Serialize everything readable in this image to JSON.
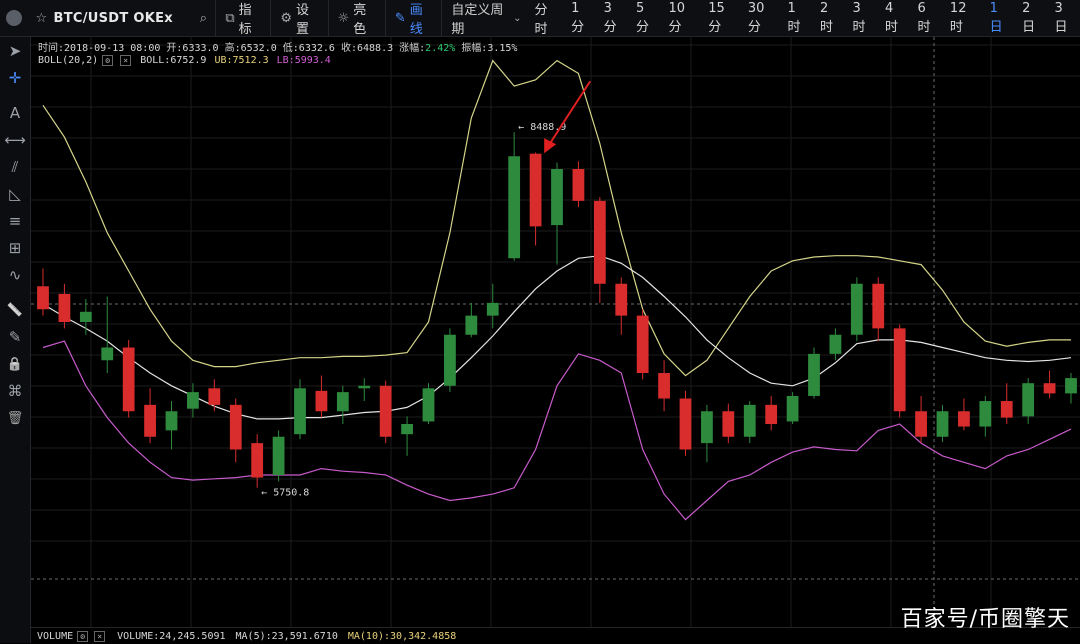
{
  "toolbar": {
    "symbol": "BTC/USDT OKEx",
    "star_icon": "star-icon",
    "search_icon": "search-icon",
    "indicators_label": "指标",
    "settings_label": "设置",
    "theme_label": "亮色",
    "draw_label": "画线",
    "custom_period_label": "自定义周期",
    "periods": [
      "分时",
      "1分",
      "3分",
      "5分",
      "10分",
      "15分",
      "30分",
      "1时",
      "2时",
      "3时",
      "4时",
      "6时",
      "12时",
      "1日",
      "2日",
      "3日"
    ],
    "active_period": "1日"
  },
  "sidebar": {
    "tools": [
      "cursor-arrow-icon",
      "crosshair-icon",
      "text-icon",
      "segment-icon",
      "parallel-lines-icon",
      "triangle-icon",
      "horizontal-lines-icon",
      "grid-icon",
      "wave-icon",
      "ruler-icon",
      "pen-icon",
      "lock-icon",
      "visibility-icon",
      "trash-icon"
    ]
  },
  "info": {
    "time_label": "时间:",
    "time": "2018-09-13 08:00",
    "open_label": "开:",
    "open": "6333.0",
    "high_label": "高:",
    "high": "6532.0",
    "low_label": "低:",
    "low": "6332.6",
    "close_label": "收:",
    "close": "6488.3",
    "change_label": "涨幅:",
    "change": "2.42%",
    "amplitude_label": "振幅:",
    "amplitude": "3.15%",
    "boll_name": "BOLL(20,2)",
    "boll_label": "BOLL:",
    "boll": "6752.9",
    "ub_label": "UB:",
    "ub": "7512.3",
    "lb_label": "LB:",
    "lb": "5993.4"
  },
  "volume": {
    "name": "VOLUME",
    "volume_label": "VOLUME:",
    "volume": "24,245.5091",
    "ma5_label": "MA(5):",
    "ma5": "23,591.6710",
    "ma10_label": "MA(10):",
    "ma10": "30,342.4858"
  },
  "watermark": "百家号/币圈擎天",
  "colors": {
    "up": "#2e8b3e",
    "down": "#d92d2d",
    "boll_mid": "#e4e4e4",
    "boll_ub": "#d4d48a",
    "boll_lb": "#c75bcb",
    "arrow": "#e02020",
    "accent": "#4a8dff"
  },
  "chart_data": {
    "type": "candlestick",
    "y_range": [
      5000,
      9000
    ],
    "annotations": [
      {
        "text": "← 8488.9",
        "index": 22,
        "price": 8488.9,
        "kind": "high"
      },
      {
        "text": "← 5750.8",
        "index": 10,
        "price": 5750.8,
        "kind": "low"
      }
    ],
    "candles": [
      [
        7280,
        7420,
        7050,
        7100
      ],
      [
        7220,
        7300,
        6950,
        7000
      ],
      [
        7000,
        7180,
        6900,
        7080
      ],
      [
        6700,
        7200,
        6600,
        6800
      ],
      [
        6800,
        6860,
        6250,
        6300
      ],
      [
        6350,
        6480,
        6050,
        6100
      ],
      [
        6150,
        6380,
        6000,
        6300
      ],
      [
        6320,
        6520,
        6250,
        6450
      ],
      [
        6480,
        6550,
        6300,
        6350
      ],
      [
        6350,
        6400,
        5900,
        6000
      ],
      [
        6050,
        6120,
        5700,
        5780
      ],
      [
        5800,
        6150,
        5750,
        6100
      ],
      [
        6120,
        6550,
        6080,
        6480
      ],
      [
        6460,
        6580,
        6250,
        6300
      ],
      [
        6300,
        6500,
        6200,
        6450
      ],
      [
        6480,
        6560,
        6380,
        6500
      ],
      [
        6500,
        6540,
        6050,
        6100
      ],
      [
        6120,
        6260,
        5950,
        6200
      ],
      [
        6220,
        6520,
        6200,
        6480
      ],
      [
        6500,
        6950,
        6450,
        6900
      ],
      [
        6900,
        7150,
        6880,
        7050
      ],
      [
        7050,
        7300,
        6950,
        7150
      ],
      [
        7500,
        8488.9,
        7480,
        8300
      ],
      [
        8320,
        8330,
        7600,
        7750
      ],
      [
        7760,
        8250,
        7450,
        8200
      ],
      [
        8200,
        8260,
        7900,
        7950
      ],
      [
        7950,
        7980,
        7150,
        7300
      ],
      [
        7300,
        7350,
        6900,
        7050
      ],
      [
        7050,
        7100,
        6550,
        6600
      ],
      [
        6600,
        6700,
        6300,
        6400
      ],
      [
        6400,
        6460,
        5950,
        6000
      ],
      [
        6050,
        6350,
        5900,
        6300
      ],
      [
        6300,
        6360,
        6050,
        6100
      ],
      [
        6100,
        6380,
        6050,
        6350
      ],
      [
        6350,
        6420,
        6150,
        6200
      ],
      [
        6220,
        6450,
        6200,
        6420
      ],
      [
        6420,
        6800,
        6400,
        6750
      ],
      [
        6750,
        6950,
        6700,
        6900
      ],
      [
        6900,
        7350,
        6850,
        7300
      ],
      [
        7300,
        7350,
        6850,
        6950
      ],
      [
        6950,
        6980,
        6250,
        6300
      ],
      [
        6300,
        6420,
        6050,
        6100
      ],
      [
        6100,
        6350,
        6060,
        6300
      ],
      [
        6300,
        6400,
        6150,
        6180
      ],
      [
        6180,
        6420,
        6100,
        6380
      ],
      [
        6380,
        6520,
        6200,
        6250
      ],
      [
        6260,
        6560,
        6200,
        6520
      ],
      [
        6520,
        6620,
        6400,
        6440
      ],
      [
        6440,
        6600,
        6360,
        6560
      ]
    ],
    "boll_mid": [
      7140,
      7040,
      6950,
      6850,
      6720,
      6600,
      6500,
      6420,
      6340,
      6280,
      6240,
      6240,
      6250,
      6250,
      6270,
      6290,
      6300,
      6330,
      6420,
      6560,
      6720,
      6890,
      7080,
      7260,
      7400,
      7500,
      7520,
      7460,
      7350,
      7200,
      7040,
      6860,
      6720,
      6600,
      6520,
      6500,
      6560,
      6680,
      6830,
      6860,
      6860,
      6840,
      6800,
      6760,
      6720,
      6700,
      6690,
      6700,
      6720
    ],
    "boll_ub": [
      8700,
      8450,
      8100,
      7700,
      7400,
      7100,
      6850,
      6700,
      6650,
      6650,
      6680,
      6700,
      6720,
      6720,
      6730,
      6730,
      6740,
      6760,
      7000,
      7700,
      8600,
      9050,
      8850,
      8900,
      9050,
      8950,
      8400,
      7700,
      7100,
      6750,
      6580,
      6700,
      6950,
      7200,
      7400,
      7480,
      7510,
      7520,
      7520,
      7510,
      7480,
      7450,
      7250,
      7000,
      6850,
      6810,
      6840,
      6860,
      6860
    ],
    "boll_lb": [
      6800,
      6850,
      6500,
      6250,
      6050,
      5900,
      5780,
      5760,
      5770,
      5780,
      5800,
      5800,
      5800,
      5850,
      5830,
      5820,
      5800,
      5720,
      5650,
      5600,
      5620,
      5650,
      5700,
      6000,
      6500,
      6750,
      6700,
      6600,
      6000,
      5650,
      5450,
      5600,
      5750,
      5800,
      5900,
      5980,
      6020,
      6000,
      5990,
      6150,
      6200,
      6050,
      5950,
      5900,
      5850,
      5950,
      6000,
      6080,
      6160
    ]
  }
}
